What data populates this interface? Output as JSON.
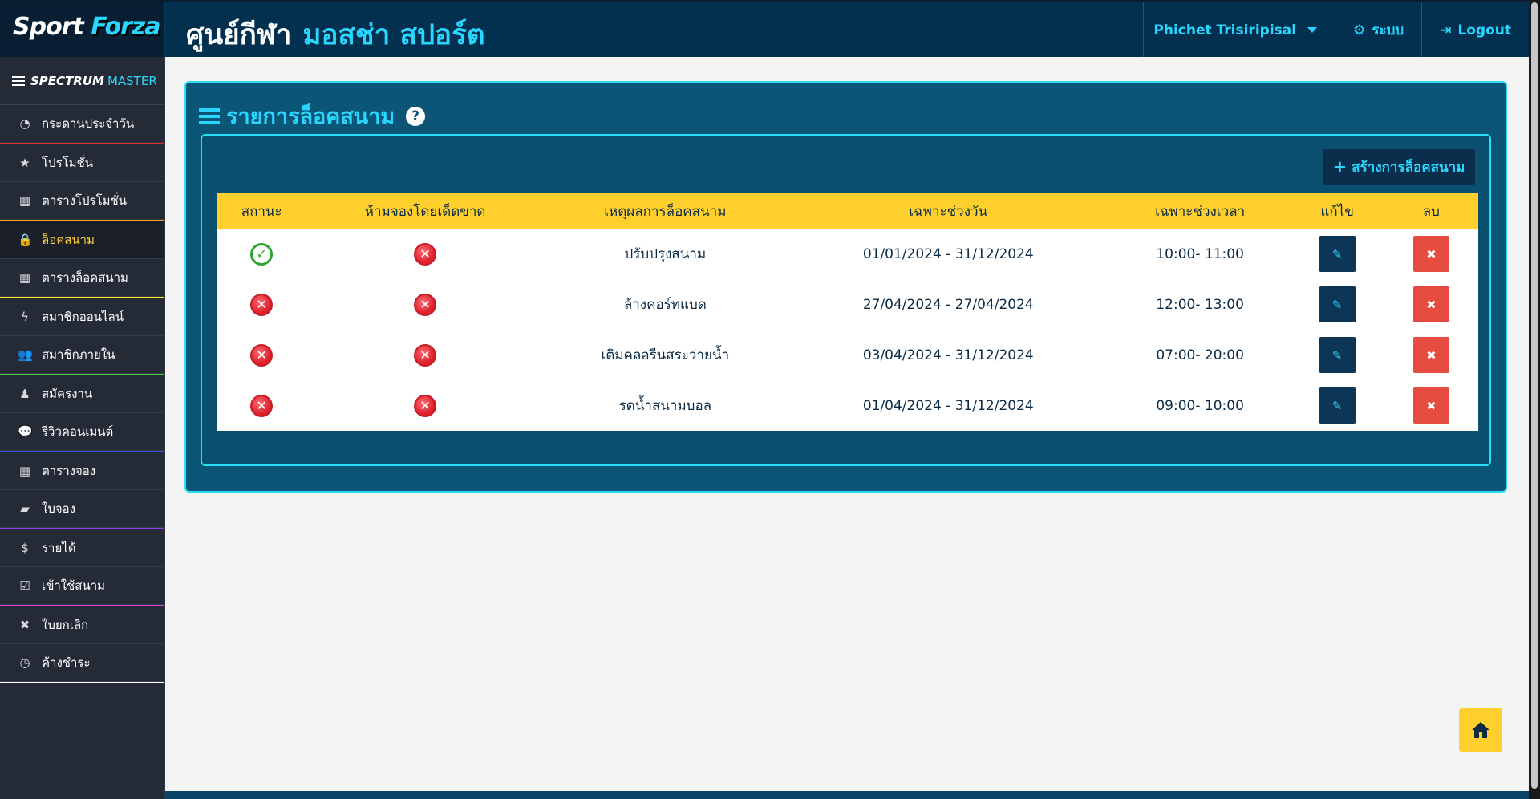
{
  "brand": {
    "part1": "Sport",
    "part2": "Forza"
  },
  "header": {
    "title": "ศูนย์กีฬา",
    "venue": "มอสช่า สปอร์ต",
    "user": "Phichet Trisiripisal",
    "system_label": "ระบบ",
    "logout_label": "Logout"
  },
  "sidebar": {
    "brand_a": "SPECTRUM",
    "brand_b": "MASTER",
    "items": [
      {
        "label": "กระดานประจำวัน",
        "icon": "dashboard-icon",
        "glyph": "◔",
        "sep": "#e22a2a"
      },
      {
        "label": "โปรโมชั่น",
        "icon": "star-icon",
        "glyph": "★",
        "sep": ""
      },
      {
        "label": "ตารางโปรโมชั่น",
        "icon": "table-icon",
        "glyph": "▦",
        "sep": "#f39a1b"
      },
      {
        "label": "ล็อคสนาม",
        "icon": "lock-icon",
        "glyph": "🔒",
        "sep": ""
      },
      {
        "label": "ตารางล็อคสนาม",
        "icon": "table-icon",
        "glyph": "▦",
        "sep": "#ffe31b"
      },
      {
        "label": "สมาชิกออนไลน์",
        "icon": "bolt-icon",
        "glyph": "ϟ",
        "sep": ""
      },
      {
        "label": "สมาชิกภายใน",
        "icon": "users-icon",
        "glyph": "👥",
        "sep": "#43d13b"
      },
      {
        "label": "สมัครงาน",
        "icon": "user-tie-icon",
        "glyph": "♟",
        "sep": ""
      },
      {
        "label": "รีวิวคอนเมนต์",
        "icon": "comment-icon",
        "glyph": "💬",
        "sep": "#2b55e3"
      },
      {
        "label": "ตารางจอง",
        "icon": "table-icon",
        "glyph": "▦",
        "sep": ""
      },
      {
        "label": "ใบจอง",
        "icon": "book-icon",
        "glyph": "▰",
        "sep": "#8a3df0"
      },
      {
        "label": "รายได้",
        "icon": "dollar-icon",
        "glyph": "$",
        "sep": ""
      },
      {
        "label": "เข้าใช้สนาม",
        "icon": "check-square-icon",
        "glyph": "☑",
        "sep": "#e23bd5"
      },
      {
        "label": "ใบยกเลิก",
        "icon": "close-icon",
        "glyph": "✖",
        "sep": ""
      },
      {
        "label": "ค้างชำระ",
        "icon": "clock-icon",
        "glyph": "◷",
        "sep": "#ffffff"
      }
    ],
    "active_index": 3
  },
  "panel": {
    "title": "รายการล็อคสนาม",
    "create_label": "สร้างการล็อคสนาม",
    "columns": [
      "สถานะ",
      "ห้ามจองโดยเด็ดขาด",
      "เหตุผลการล็อคสนาม",
      "เฉพาะช่วงวัน",
      "เฉพาะช่วงเวลา",
      "แก้ไข",
      "ลบ"
    ],
    "rows": [
      {
        "status": true,
        "strict": false,
        "reason": "ปรับปรุงสนาม",
        "dates": "01/01/2024 - 31/12/2024",
        "times": "10:00- 11:00"
      },
      {
        "status": false,
        "strict": false,
        "reason": "ล้างคอร์ทแบด",
        "dates": "27/04/2024 - 27/04/2024",
        "times": "12:00- 13:00"
      },
      {
        "status": false,
        "strict": false,
        "reason": "เติมคลอรีนสระว่ายน้ำ",
        "dates": "03/04/2024 - 31/12/2024",
        "times": "07:00- 20:00"
      },
      {
        "status": false,
        "strict": false,
        "reason": "รดน้ำสนามบอล",
        "dates": "01/04/2024 - 31/12/2024",
        "times": "09:00- 10:00"
      }
    ]
  },
  "colors": {
    "accent": "#29d6ff",
    "header_bg": "#03304f",
    "panel_bg": "#0b5677",
    "table_header": "#ffd02d",
    "delete": "#e64c3f"
  }
}
